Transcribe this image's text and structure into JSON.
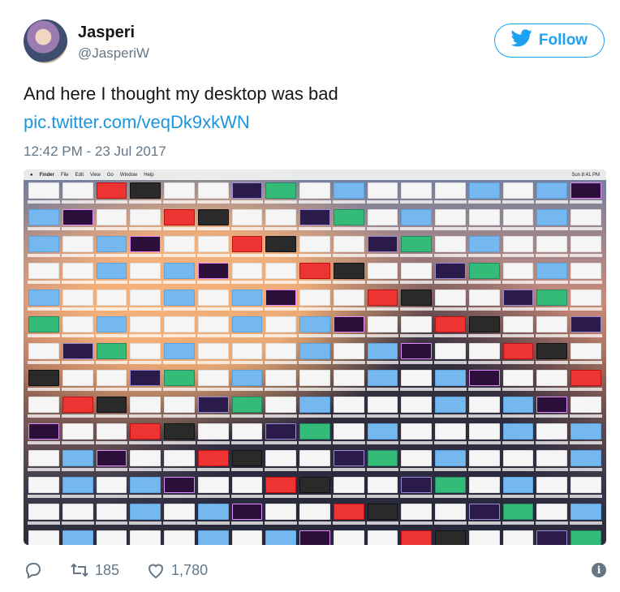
{
  "user": {
    "name": "Jasperi",
    "handle": "@JasperiW"
  },
  "follow_button": {
    "label": "Follow"
  },
  "tweet": {
    "text": "And here I thought my desktop was bad",
    "link": "pic.twitter.com/veqDk9xkWN",
    "timestamp": "12:42 PM - 23 Jul 2017"
  },
  "media": {
    "menubar": {
      "items": [
        "Finder",
        "File",
        "Edit",
        "View",
        "Go",
        "Window",
        "Help"
      ],
      "clock": "Sun 8:41 PM"
    }
  },
  "actions": {
    "retweets": "185",
    "likes": "1,780"
  },
  "colors": {
    "brand_blue": "#1da1f2",
    "link_blue": "#1b95e0",
    "muted": "#657786"
  }
}
